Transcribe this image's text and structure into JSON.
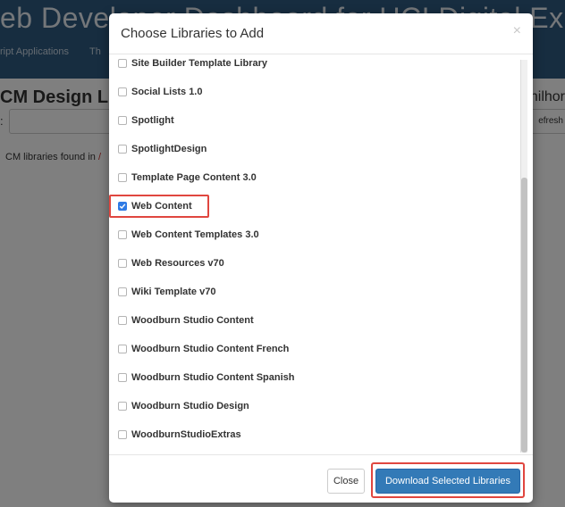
{
  "background": {
    "title": "eb Developer Dashboard for UCI Digital Experience",
    "nav": [
      "ript Applications",
      "Th"
    ],
    "heading": "CM Design Lib",
    "heading_right": "thilhor",
    "filter_label": ":",
    "refresh_label": "efresh",
    "found_text": "CM libraries found in",
    "found_slash": "/"
  },
  "modal": {
    "title": "Choose Libraries to Add",
    "close_symbol": "×",
    "libraries": [
      {
        "label": "Site Builder Template Library",
        "checked": false
      },
      {
        "label": "Social Lists 1.0",
        "checked": false
      },
      {
        "label": "Spotlight",
        "checked": false
      },
      {
        "label": "SpotlightDesign",
        "checked": false
      },
      {
        "label": "Template Page Content 3.0",
        "checked": false
      },
      {
        "label": "Web Content",
        "checked": true
      },
      {
        "label": "Web Content Templates 3.0",
        "checked": false
      },
      {
        "label": "Web Resources v70",
        "checked": false
      },
      {
        "label": "Wiki Template v70",
        "checked": false
      },
      {
        "label": "Woodburn Studio Content",
        "checked": false
      },
      {
        "label": "Woodburn Studio Content French",
        "checked": false
      },
      {
        "label": "Woodburn Studio Content Spanish",
        "checked": false
      },
      {
        "label": "Woodburn Studio Design",
        "checked": false
      },
      {
        "label": "WoodburnStudioExtras",
        "checked": false
      }
    ],
    "footer": {
      "close_label": "Close",
      "download_label": "Download Selected Libraries"
    }
  },
  "colors": {
    "header_bg": "#2f5a80",
    "primary_button": "#337ab7",
    "highlight": "#e0463f",
    "checkbox_checked": "#2f7be5"
  }
}
